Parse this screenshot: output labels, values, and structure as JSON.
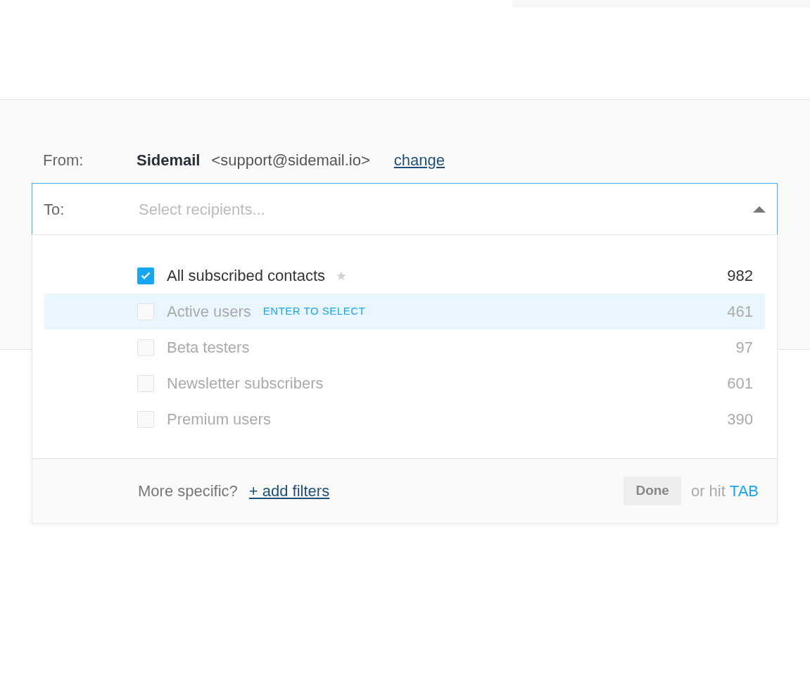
{
  "from": {
    "label": "From:",
    "name": "Sidemail",
    "email": "<support@sidemail.io>",
    "change_link": "change"
  },
  "to": {
    "label": "To:",
    "placeholder": "Select recipients...",
    "expanded": true
  },
  "recipients": [
    {
      "label": "All subscribed contacts",
      "count": "982",
      "checked": true,
      "starred": true,
      "highlighted": false
    },
    {
      "label": "Active users",
      "count": "461",
      "checked": false,
      "starred": false,
      "highlighted": true,
      "hint": "ENTER TO SELECT"
    },
    {
      "label": "Beta testers",
      "count": "97",
      "checked": false,
      "starred": false,
      "highlighted": false
    },
    {
      "label": "Newsletter subscribers",
      "count": "601",
      "checked": false,
      "starred": false,
      "highlighted": false
    },
    {
      "label": "Premium users",
      "count": "390",
      "checked": false,
      "starred": false,
      "highlighted": false
    }
  ],
  "footer": {
    "prompt": "More specific?",
    "filters_link": "+ add filters",
    "done_button": "Done",
    "or_hit": "or hit",
    "key": "TAB"
  }
}
